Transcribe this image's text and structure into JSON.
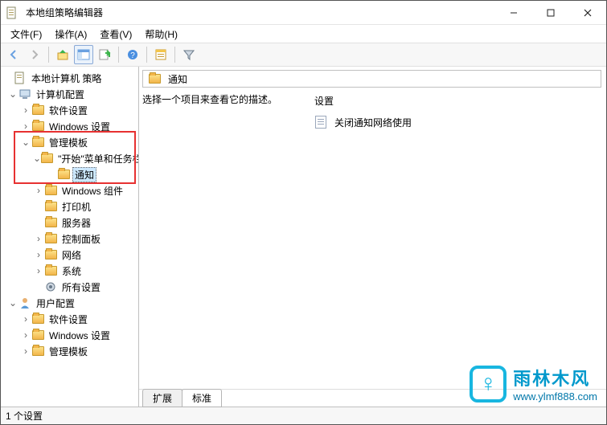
{
  "window": {
    "title": "本地组策略编辑器"
  },
  "menu": {
    "file": "文件(F)",
    "action": "操作(A)",
    "view": "查看(V)",
    "help": "帮助(H)"
  },
  "tree": {
    "root": "本地计算机 策略",
    "computer": "计算机配置",
    "sw_settings1": "软件设置",
    "win_settings1": "Windows 设置",
    "admin_templates": "管理模板",
    "start_menu": "\"开始\"菜单和任务栏",
    "notify": "通知",
    "win_components": "Windows 组件",
    "printers": "打印机",
    "servers": "服务器",
    "control_panel": "控制面板",
    "network": "网络",
    "system": "系统",
    "all_settings": "所有设置",
    "user": "用户配置",
    "sw_settings2": "软件设置",
    "win_settings2": "Windows 设置",
    "admin_templates2": "管理模板"
  },
  "right": {
    "header": "通知",
    "desc_prompt": "选择一个项目来查看它的描述。",
    "col_setting": "设置",
    "item1": "关闭通知网络使用"
  },
  "tabs": {
    "extended": "扩展",
    "standard": "标准"
  },
  "status": {
    "text": "1 个设置"
  },
  "watermark": {
    "cn": "雨林木风",
    "url": "www.ylmf888.com",
    "glyph": "♀"
  }
}
